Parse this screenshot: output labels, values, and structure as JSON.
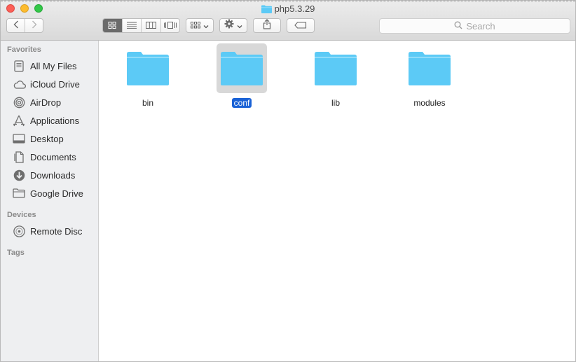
{
  "window": {
    "title": "php5.3.29"
  },
  "toolbar": {
    "back_icon": "chevron-left-icon",
    "forward_icon": "chevron-right-icon",
    "views": [
      "icon-view",
      "list-view",
      "column-view",
      "cover-flow-view"
    ],
    "active_view": "icon-view",
    "search_placeholder": "Search"
  },
  "sidebar": {
    "favorites_header": "Favorites",
    "favorites": [
      {
        "label": "All My Files",
        "icon": "all-files-icon"
      },
      {
        "label": "iCloud Drive",
        "icon": "cloud-icon"
      },
      {
        "label": "AirDrop",
        "icon": "airdrop-icon"
      },
      {
        "label": "Applications",
        "icon": "applications-icon"
      },
      {
        "label": "Desktop",
        "icon": "desktop-icon"
      },
      {
        "label": "Documents",
        "icon": "documents-icon"
      },
      {
        "label": "Downloads",
        "icon": "downloads-icon"
      },
      {
        "label": "Google Drive",
        "icon": "folder-icon"
      }
    ],
    "devices_header": "Devices",
    "devices": [
      {
        "label": "Remote Disc",
        "icon": "disc-icon"
      }
    ],
    "tags_header": "Tags"
  },
  "content": {
    "items": [
      {
        "name": "bin",
        "selected": false
      },
      {
        "name": "conf",
        "selected": true
      },
      {
        "name": "lib",
        "selected": false
      },
      {
        "name": "modules",
        "selected": false
      }
    ]
  },
  "colors": {
    "folder_body": "#5ccaf6",
    "folder_tab": "#7fd6f8",
    "selection": "#1a62d6",
    "sidebar_bg": "#eeeff1"
  }
}
